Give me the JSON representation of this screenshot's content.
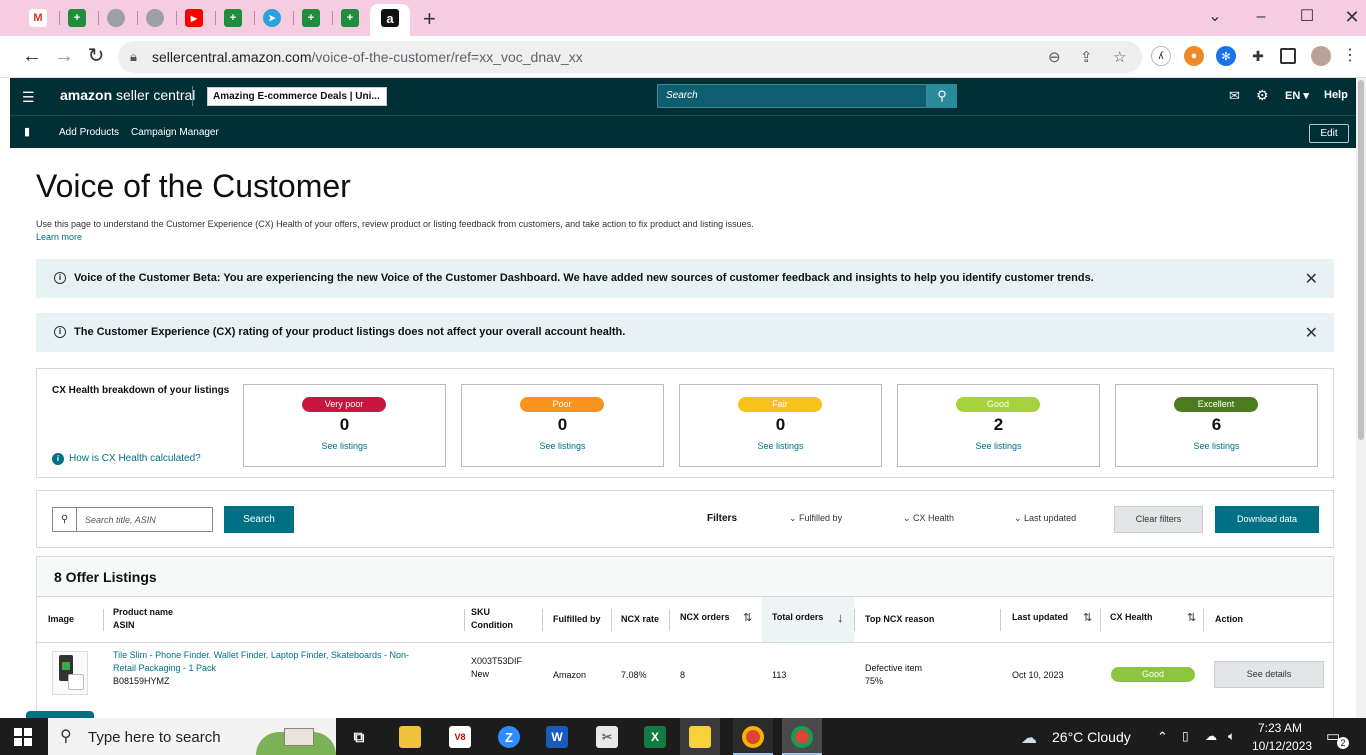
{
  "browser": {
    "tabs": [
      {
        "icon": "gmail-icon",
        "label": "M"
      },
      {
        "icon": "sheets-icon",
        "label": "+"
      },
      {
        "icon": "globe-icon",
        "label": ""
      },
      {
        "icon": "globe-icon",
        "label": ""
      },
      {
        "icon": "youtube-icon",
        "label": "▶"
      },
      {
        "icon": "sheets-icon",
        "label": "+"
      },
      {
        "icon": "telegram-icon",
        "label": "➤"
      },
      {
        "icon": "sheets-icon",
        "label": "+"
      },
      {
        "icon": "sheets-icon",
        "label": "+"
      },
      {
        "icon": "amazon-icon",
        "label": "a"
      }
    ],
    "url_domain": "sellercentral.amazon.com",
    "url_path": "/voice-of-the-customer/ref=xx_voc_dnav_xx"
  },
  "header": {
    "logo_brand": "amazon",
    "logo_product": " seller central",
    "store_name": "Amazing E-commerce Deals | Uni...",
    "search_placeholder": "Search",
    "language": "EN ▾",
    "help": "Help",
    "nav_links": [
      "Add Products",
      "Campaign Manager"
    ],
    "edit_label": "Edit"
  },
  "page": {
    "title": "Voice of the Customer",
    "description": "Use this page to understand the Customer Experience (CX) Health of your offers, review product or listing feedback from customers, and take action to fix product and listing issues.",
    "learn_more": "Learn more",
    "alerts": [
      "Voice of the Customer Beta: You are experiencing the new Voice of the Customer Dashboard. We have added new sources of customer feedback and insights to help you identify customer trends.",
      "The Customer Experience (CX) rating of your product listings does not affect your overall account health."
    ]
  },
  "cx_health": {
    "title": "CX Health breakdown of your listings",
    "help_link": "How is CX Health calculated?",
    "cards": [
      {
        "label": "Very poor",
        "count": "0",
        "link": "See listings",
        "color": "#c7163f"
      },
      {
        "label": "Poor",
        "count": "0",
        "link": "See listings",
        "color": "#f7941d"
      },
      {
        "label": "Fair",
        "count": "0",
        "link": "See listings",
        "color": "#f8c21b"
      },
      {
        "label": "Good",
        "count": "2",
        "link": "See listings",
        "color": "#a6d23d"
      },
      {
        "label": "Excellent",
        "count": "6",
        "link": "See listings",
        "color": "#4b7b1e"
      }
    ]
  },
  "filters": {
    "search_placeholder": "Search title, ASIN",
    "search_button": "Search",
    "label": "Filters",
    "dropdowns": [
      "Fulfilled by",
      "CX Health",
      "Last updated"
    ],
    "clear": "Clear filters",
    "download": "Download data"
  },
  "listings": {
    "title": "8 Offer Listings",
    "columns": {
      "image": "Image",
      "product_name": "Product name",
      "asin": "ASIN",
      "sku": "SKU",
      "condition": "Condition",
      "fulfilled_by": "Fulfilled by",
      "ncx_rate": "NCX rate",
      "ncx_orders": "NCX orders",
      "total_orders": "Total orders",
      "top_reason": "Top NCX reason",
      "last_updated": "Last updated",
      "cx_health": "CX Health",
      "action": "Action"
    },
    "rows": [
      {
        "name_line1": "Tile Slim - Phone Finder. Wallet Finder. Laptop Finder, Skateboards - Non-",
        "name_line2": "Retail Packaging - 1 Pack",
        "asin": "B08159HYMZ",
        "sku": "X003T53DIF",
        "condition": "New",
        "fulfilled_by": "Amazon",
        "ncx_rate": "7.08%",
        "ncx_orders": "8",
        "total_orders": "113",
        "reason": "Defective item",
        "reason_pct": "75%",
        "last_updated": "Oct 10, 2023",
        "cx_health": "Good",
        "action": "See details"
      }
    ]
  },
  "taskbar": {
    "search_placeholder": "Type here to search",
    "weather": "26°C  Cloudy",
    "time": "7:23 AM",
    "date": "10/12/2023",
    "notification_count": "2"
  }
}
